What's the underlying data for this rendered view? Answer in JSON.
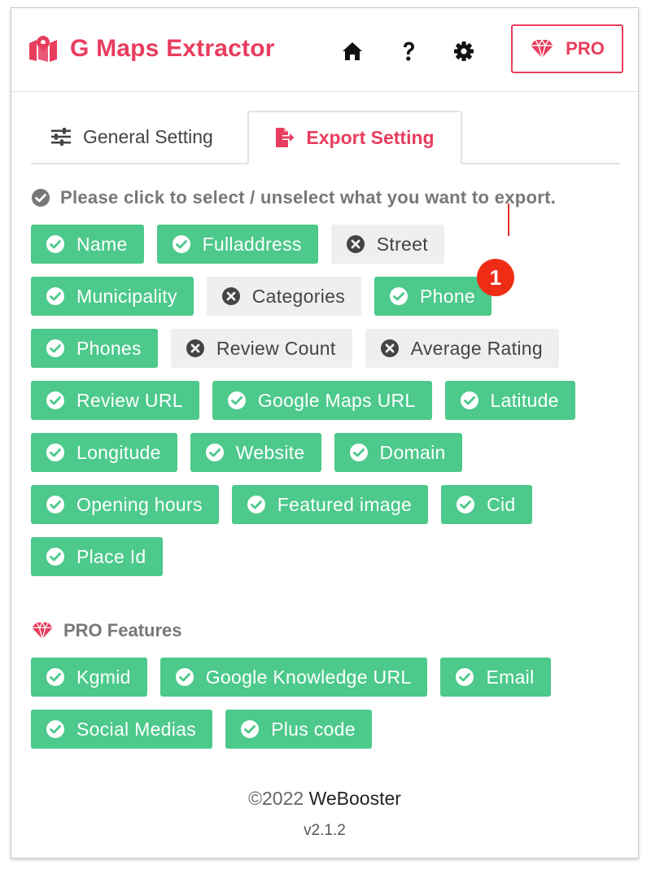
{
  "header": {
    "app_title": "G Maps Extractor",
    "pro_button_label": "PRO",
    "icons": [
      "map-marker-icon",
      "home-icon",
      "help-icon",
      "gear-icon",
      "diamond-icon"
    ]
  },
  "tabs": [
    {
      "label": "General Setting",
      "icon": "sliders-icon",
      "active": false
    },
    {
      "label": "Export Setting",
      "icon": "file-export-icon",
      "active": true
    }
  ],
  "instruction": "Please click to select / unselect what you want to export.",
  "fields": [
    {
      "label": "Name",
      "selected": true
    },
    {
      "label": "Fulladdress",
      "selected": true
    },
    {
      "label": "Street",
      "selected": false
    },
    {
      "label": "Municipality",
      "selected": true
    },
    {
      "label": "Categories",
      "selected": false
    },
    {
      "label": "Phone",
      "selected": true,
      "badge": "1"
    },
    {
      "label": "Phones",
      "selected": true
    },
    {
      "label": "Review Count",
      "selected": false
    },
    {
      "label": "Average Rating",
      "selected": false
    },
    {
      "label": "Review URL",
      "selected": true
    },
    {
      "label": "Google Maps URL",
      "selected": true
    },
    {
      "label": "Latitude",
      "selected": true
    },
    {
      "label": "Longitude",
      "selected": true
    },
    {
      "label": "Website",
      "selected": true
    },
    {
      "label": "Domain",
      "selected": true
    },
    {
      "label": "Opening hours",
      "selected": true
    },
    {
      "label": "Featured image",
      "selected": true
    },
    {
      "label": "Cid",
      "selected": true
    },
    {
      "label": "Place Id",
      "selected": true
    }
  ],
  "pro_features": {
    "title": "PRO Features",
    "fields": [
      {
        "label": "Kgmid",
        "selected": true
      },
      {
        "label": "Google Knowledge URL",
        "selected": true
      },
      {
        "label": "Email",
        "selected": true
      },
      {
        "label": "Social Medias",
        "selected": true
      },
      {
        "label": "Plus code",
        "selected": true
      }
    ]
  },
  "footer": {
    "copyright_symbol": "©2022",
    "brand": "WeBooster",
    "version": "v2.1.2"
  },
  "colors": {
    "brand": "#e83d5e",
    "selected_chip": "#4cc98b",
    "unselected_chip": "#efefef",
    "badge": "#ef2d17"
  }
}
